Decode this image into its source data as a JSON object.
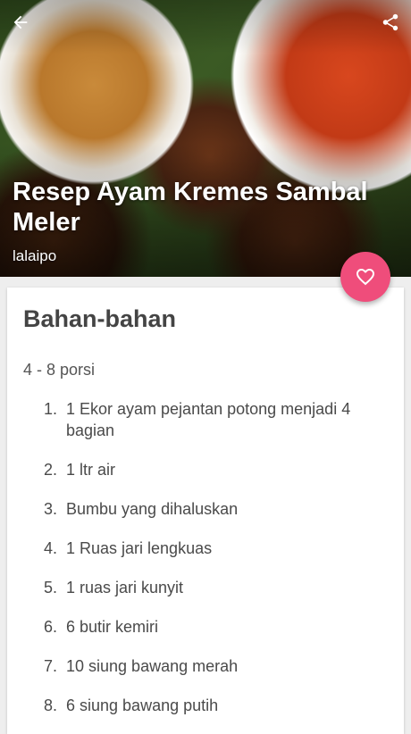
{
  "header": {
    "title": "Resep Ayam Kremes Sambal Meler",
    "author": "lalaipo"
  },
  "icons": {
    "back": "arrow-left-icon",
    "share": "share-icon",
    "favorite": "heart-outline-icon"
  },
  "colors": {
    "accent": "#ef4d7b"
  },
  "ingredients": {
    "heading": "Bahan-bahan",
    "servings": "4 - 8 porsi",
    "items": [
      {
        "num": "1.",
        "text": "1 Ekor ayam pejantan potong menjadi 4 bagian"
      },
      {
        "num": "2.",
        "text": "1 ltr air"
      },
      {
        "num": "3.",
        "text": "Bumbu yang dihaluskan"
      },
      {
        "num": "4.",
        "text": "1 Ruas jari lengkuas"
      },
      {
        "num": "5.",
        "text": "1 ruas jari kunyit"
      },
      {
        "num": "6.",
        "text": "6 butir kemiri"
      },
      {
        "num": "7.",
        "text": "10 siung bawang merah"
      },
      {
        "num": "8.",
        "text": "6 siung bawang putih"
      }
    ]
  }
}
